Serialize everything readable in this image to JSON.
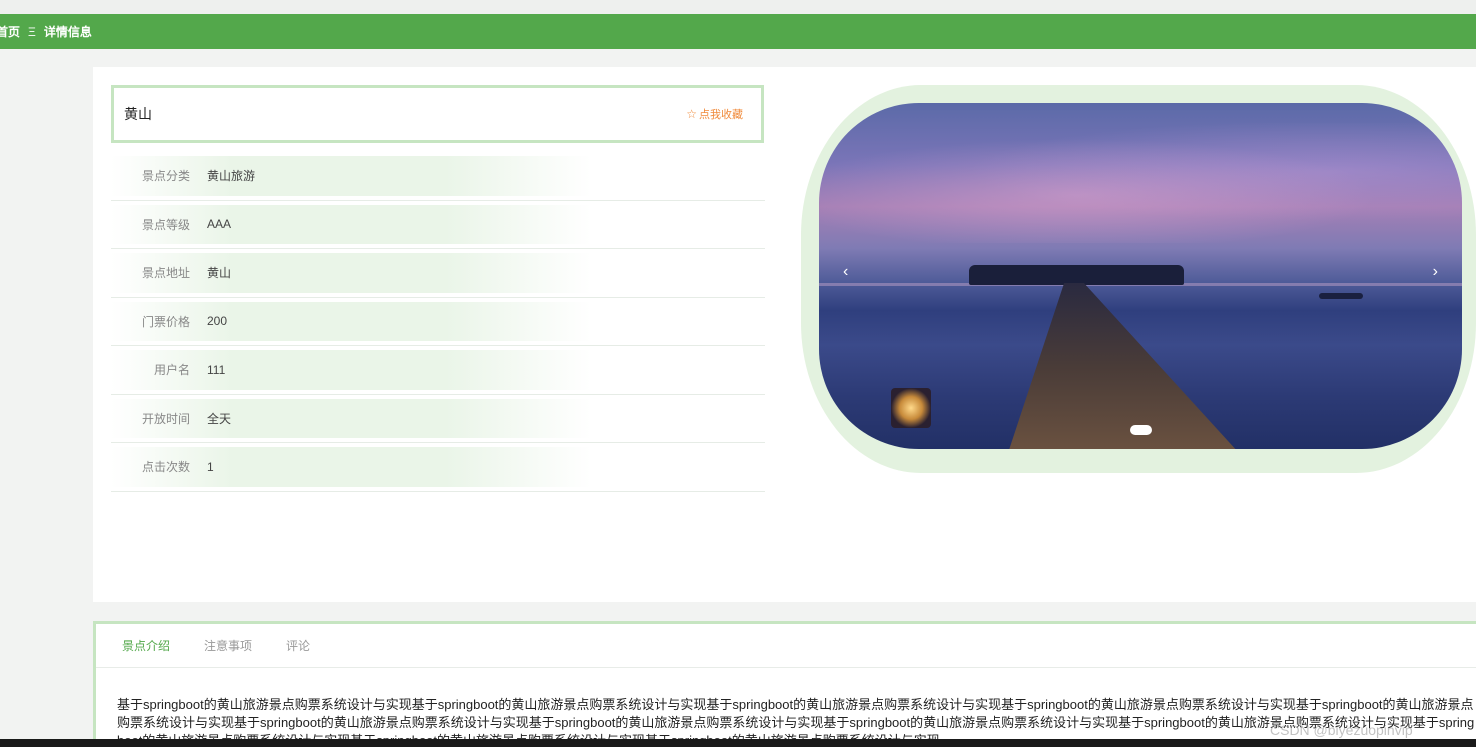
{
  "breadcrumb": {
    "home": "首页",
    "separator": "Ξ",
    "current": "详情信息"
  },
  "spot": {
    "name": "黄山",
    "collect_label": "点我收藏",
    "collect_icon": "star-outline-icon"
  },
  "info": [
    {
      "label": "景点分类",
      "value": "黄山旅游"
    },
    {
      "label": "景点等级",
      "value": "AAA"
    },
    {
      "label": "景点地址",
      "value": "黄山"
    },
    {
      "label": "门票价格",
      "value": "200"
    },
    {
      "label": "用户名",
      "value": "111"
    },
    {
      "label": "开放时间",
      "value": "全天"
    },
    {
      "label": "点击次数",
      "value": "1"
    }
  ],
  "carousel": {
    "prev": "‹",
    "next": "›",
    "slide_count": 1,
    "active_index": 0
  },
  "tabs": [
    {
      "label": "景点介绍",
      "active": true
    },
    {
      "label": "注意事项",
      "active": false
    },
    {
      "label": "评论",
      "active": false
    }
  ],
  "description": "基于springboot的黄山旅游景点购票系统设计与实现基于springboot的黄山旅游景点购票系统设计与实现基于springboot的黄山旅游景点购票系统设计与实现基于springboot的黄山旅游景点购票系统设计与实现基于springboot的黄山旅游景点购票系统设计与实现基于springboot的黄山旅游景点购票系统设计与实现基于springboot的黄山旅游景点购票系统设计与实现基于springboot的黄山旅游景点购票系统设计与实现基于springboot的黄山旅游景点购票系统设计与实现基于springboot的黄山旅游景点购票系统设计与实现基于springboot的黄山旅游景点购票系统设计与实现基于springboot的黄山旅游景点购票系统设计与实现",
  "watermark": "CSDN @biyezuopinvip",
  "colors": {
    "primary": "#53a84b",
    "accent_border": "#c6e5c1",
    "collect": "#f08a3a"
  }
}
